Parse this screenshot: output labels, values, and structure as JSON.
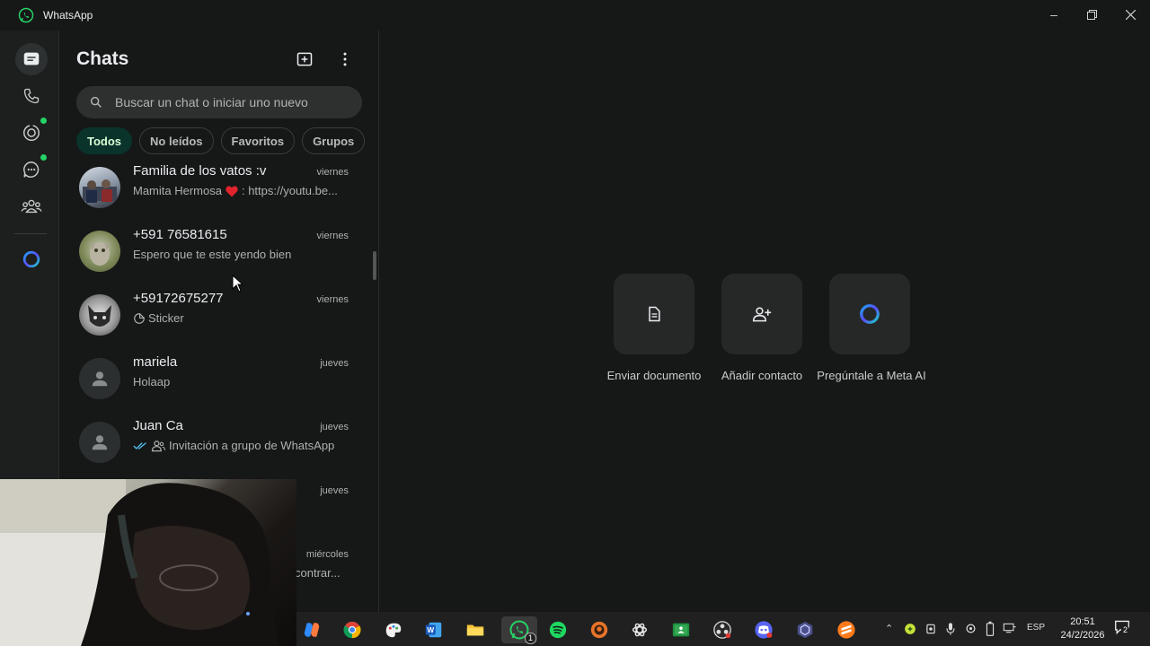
{
  "window": {
    "title": "WhatsApp"
  },
  "sidebar": {
    "items": [
      {
        "name": "chats-icon",
        "active": true
      },
      {
        "name": "calls-icon"
      },
      {
        "name": "status-icon",
        "badge": true
      },
      {
        "name": "channels-icon",
        "badge": true
      },
      {
        "name": "communities-icon"
      },
      {
        "name": "meta-ai-icon"
      }
    ]
  },
  "chats_panel": {
    "title": "Chats",
    "search_placeholder": "Buscar un chat o iniciar uno nuevo",
    "filters": [
      "Todos",
      "No leídos",
      "Favoritos",
      "Grupos"
    ],
    "active_filter": "Todos",
    "chats": [
      {
        "name": "Familia de los vatos :v",
        "time": "viernes",
        "prefix": "Mamita Hermosa",
        "heart": true,
        "message": ": https://youtu.be..."
      },
      {
        "name": "+591 76581615",
        "time": "viernes",
        "message": "Espero que te este yendo bien"
      },
      {
        "name": "+59172675277",
        "time": "viernes",
        "sticker": true,
        "message": "Sticker"
      },
      {
        "name": "mariela",
        "time": "jueves",
        "message": "Holaap"
      },
      {
        "name": "Juan Ca",
        "time": "jueves",
        "ticks": true,
        "group_icon": true,
        "message": "Invitación a grupo de WhatsApp"
      },
      {
        "name": "",
        "time": "jueves",
        "message": ""
      },
      {
        "name": "",
        "time": "miércoles",
        "message": "contrar..."
      }
    ]
  },
  "main": {
    "actions": [
      {
        "label": "Enviar documento",
        "icon": "document-icon"
      },
      {
        "label": "Añadir contacto",
        "icon": "add-contact-icon"
      },
      {
        "label": "Pregúntale a Meta AI",
        "icon": "meta-ai-icon"
      }
    ]
  },
  "taskbar": {
    "whatsapp_badge": "1",
    "lang": "ESP",
    "time": "20:51",
    "date": "24/2/2026",
    "notifications": "2"
  },
  "colors": {
    "accent": "#25d366",
    "background": "#161717",
    "chip_active_bg": "#0a332c"
  }
}
